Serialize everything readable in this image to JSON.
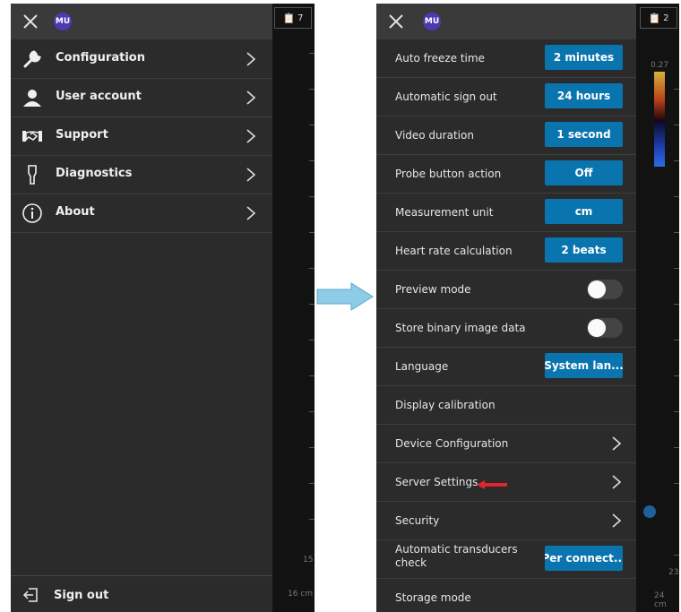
{
  "left_panel": {
    "avatar": "MU",
    "menu": [
      {
        "label": "Configuration",
        "icon": "wrench-icon"
      },
      {
        "label": "User account",
        "icon": "user-icon"
      },
      {
        "label": "Support",
        "icon": "handshake-icon"
      },
      {
        "label": "Diagnostics",
        "icon": "probe-icon"
      },
      {
        "label": "About",
        "icon": "info-icon"
      }
    ],
    "sign_out": "Sign out",
    "badge_count": "7",
    "scale_label": "15",
    "depth_label": "16 cm"
  },
  "right_panel": {
    "avatar": "MU",
    "badge_count": "2",
    "colorbar_value": "0.27",
    "scale_label": "23",
    "depth_label": "24 cm",
    "settings": [
      {
        "label": "Auto freeze time",
        "control": "button",
        "value": "2 minutes"
      },
      {
        "label": "Automatic sign out",
        "control": "button",
        "value": "24 hours"
      },
      {
        "label": "Video duration",
        "control": "button",
        "value": "1 second"
      },
      {
        "label": "Probe button action",
        "control": "button",
        "value": "Off"
      },
      {
        "label": "Measurement unit",
        "control": "button",
        "value": "cm"
      },
      {
        "label": "Heart rate calculation",
        "control": "button",
        "value": "2 beats"
      },
      {
        "label": "Preview mode",
        "control": "toggle",
        "value": "off"
      },
      {
        "label": "Store binary image data",
        "control": "toggle",
        "value": "off"
      },
      {
        "label": "Language",
        "control": "button",
        "value": "System lan..."
      },
      {
        "label": "Display calibration",
        "control": "none"
      },
      {
        "label": "Device Configuration",
        "control": "chevron"
      },
      {
        "label": "Server Settings",
        "control": "chevron"
      },
      {
        "label": "Security",
        "control": "chevron"
      },
      {
        "label": "Automatic transducers check",
        "control": "button",
        "value": "Per connect..."
      },
      {
        "label": "Storage mode",
        "control": "none"
      }
    ]
  },
  "colors": {
    "panel_bg": "#2b2b2b",
    "topbar_bg": "#3a3a3a",
    "accent_button": "#0a74ae",
    "avatar": "#4b3bb0",
    "arrow_fill": "#8ecbe6",
    "pointer_red": "#e0262a"
  }
}
